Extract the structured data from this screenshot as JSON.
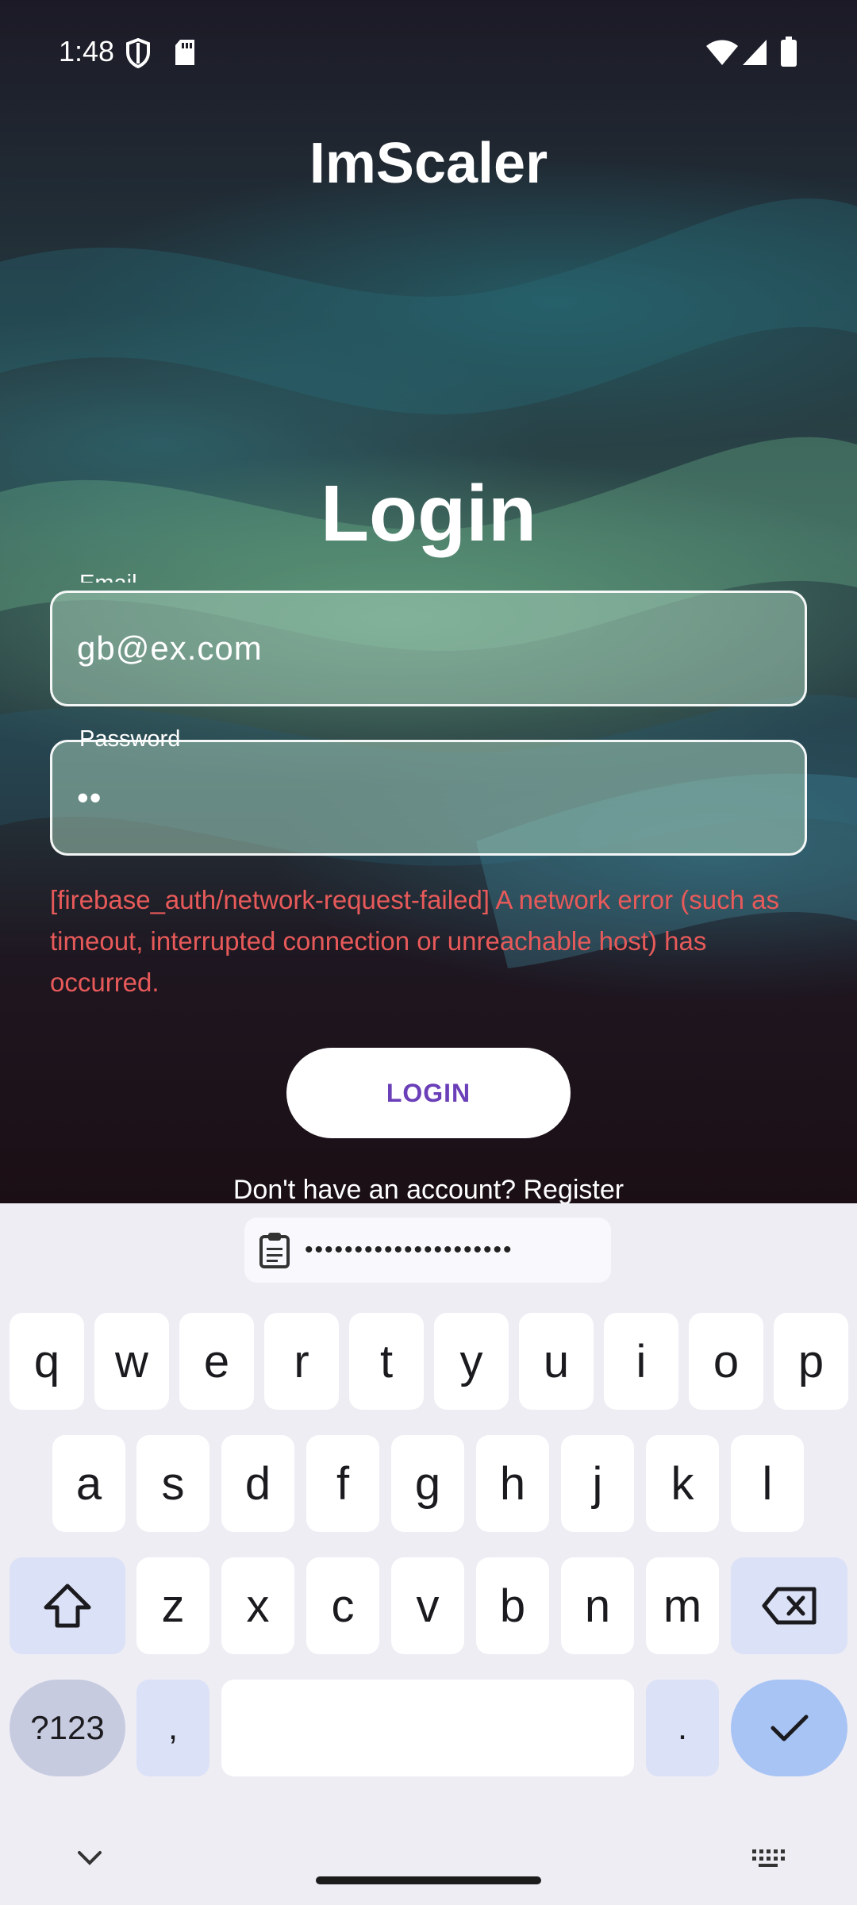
{
  "status_bar": {
    "time": "1:48",
    "icons": [
      "shield-icon",
      "sd-card-icon",
      "wifi-icon",
      "signal-icon",
      "battery-icon"
    ]
  },
  "app": {
    "title": "ImScaler",
    "heading": "Login",
    "email": {
      "label": "Email",
      "value": "gb@ex.com"
    },
    "password": {
      "label": "Password",
      "value": "••"
    },
    "error": "[firebase_auth/network-request-failed] A network error (such as timeout, interrupted connection or unreachable host) has occurred.",
    "login_button": "LOGIN",
    "register_prompt": "Don't have an account? Register"
  },
  "keyboard": {
    "suggestion": "•••••••••••••••••••••",
    "row1": [
      "q",
      "w",
      "e",
      "r",
      "t",
      "y",
      "u",
      "i",
      "o",
      "p"
    ],
    "row2": [
      "a",
      "s",
      "d",
      "f",
      "g",
      "h",
      "j",
      "k",
      "l"
    ],
    "row3": [
      "z",
      "x",
      "c",
      "v",
      "b",
      "n",
      "m"
    ],
    "symbols_key": "?123",
    "comma_key": ",",
    "period_key": "."
  },
  "colors": {
    "error": "#e85a5a",
    "button_text": "#6a3fb8",
    "keyboard_bg": "#eeedf4",
    "enter_key": "#a8c4f5"
  }
}
